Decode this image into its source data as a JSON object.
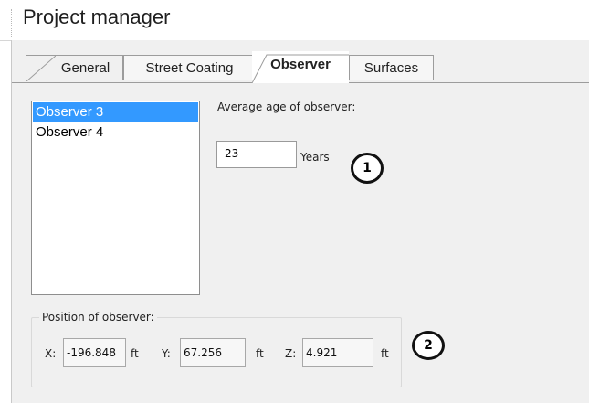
{
  "title": "Project manager",
  "tabs": [
    {
      "label": "General",
      "active": false
    },
    {
      "label": "Street Coating",
      "active": false
    },
    {
      "label": "Observer",
      "active": true
    },
    {
      "label": "Surfaces",
      "active": false
    }
  ],
  "observers": {
    "items": [
      "Observer 3",
      "Observer 4"
    ],
    "selected": "Observer 3"
  },
  "age": {
    "label": "Average age of observer:",
    "value": "23",
    "unit": "Years"
  },
  "position": {
    "title": "Position of observer:",
    "x_label": "X:",
    "x_value": "-196.848",
    "x_unit": "ft",
    "y_label": "Y:",
    "y_value": "67.256",
    "y_unit": "ft",
    "z_label": "Z:",
    "z_value": "4.921",
    "z_unit": "ft"
  },
  "callouts": [
    "1",
    "2"
  ],
  "colors": {
    "selection": "#3399ff",
    "panel_bg": "#f0f0f0"
  }
}
